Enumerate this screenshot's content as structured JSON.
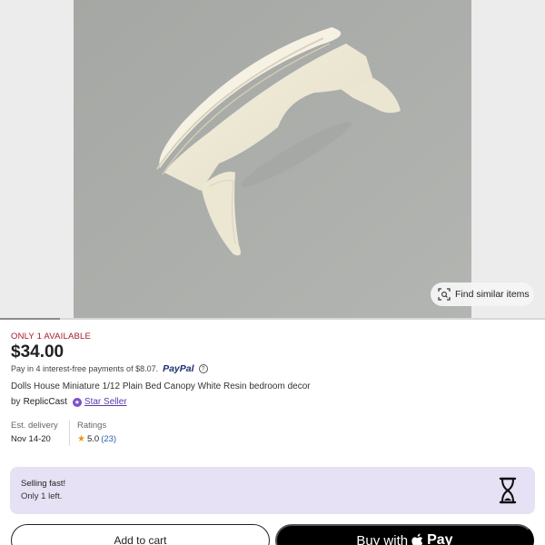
{
  "gallery": {
    "find_similar_label": "Find similar items",
    "progress_fraction": 0.11,
    "icons": {
      "find_similar": "scan-image-icon"
    }
  },
  "listing": {
    "stock_text": "ONLY 1 AVAILABLE",
    "price": "$34.00",
    "installments_text": "Pay in 4 interest-free payments of $8.07.",
    "paypal_label": "PayPal",
    "title": "Dolls House Miniature 1/12 Plain Bed Canopy White Resin bedroom decor",
    "seller_prefix": "by",
    "seller_name": "ReplicCast",
    "star_seller_label": "Star Seller"
  },
  "delivery": {
    "label": "Est. delivery",
    "value": "Nov 14-20"
  },
  "ratings": {
    "label": "Ratings",
    "score": "5.0",
    "count": "(23)"
  },
  "selling_fast": {
    "heading": "Selling fast!",
    "subtext": "Only 1 left.",
    "icon": "hourglass-icon"
  },
  "actions": {
    "add_to_cart": "Add to cart",
    "buy_with": "Buy with",
    "pay": "Pay"
  },
  "colors": {
    "accent_purple": "#7b4fc7",
    "stock_red": "#a61a2e",
    "banner_bg": "#e6e1f4",
    "star": "#e59a17"
  }
}
